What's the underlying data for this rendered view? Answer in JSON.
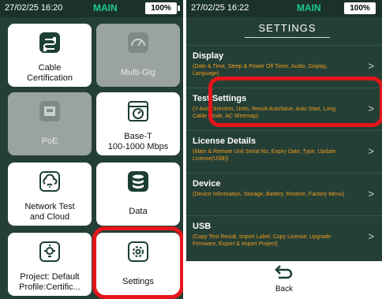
{
  "left_screen": {
    "status": {
      "time": "27/02/25 16:20",
      "title": "MAIN",
      "battery": "100%"
    },
    "tiles": [
      {
        "label": "Cable\nCertification",
        "icon": "cable-icon",
        "disabled": false
      },
      {
        "label": "Multi-Gig",
        "icon": "speedometer-icon",
        "disabled": true
      },
      {
        "label": "PoE",
        "icon": "ethernet-port-icon",
        "disabled": true
      },
      {
        "label": "Base-T\n100-1000 Mbps",
        "icon": "speed-meter-icon",
        "disabled": false
      },
      {
        "label": "Network Test\nand Cloud",
        "icon": "cloud-wifi-icon",
        "disabled": false
      },
      {
        "label": "Data",
        "icon": "database-icon",
        "disabled": false
      },
      {
        "label": "Project: Default\nProfile:Certific...",
        "icon": "lightbulb-icon",
        "disabled": false
      },
      {
        "label": "Settings",
        "icon": "gear-icon",
        "disabled": false
      }
    ],
    "highlighted_tile": "Settings"
  },
  "right_screen": {
    "status": {
      "time": "27/02/25 16:22",
      "title": "MAIN",
      "battery": "100%"
    },
    "heading": "SETTINGS",
    "items": [
      {
        "title": "Display",
        "desc": "(Date & Time, Sleep & Power Off Timer, Audio, Display, Language)"
      },
      {
        "title": "Test Settings",
        "desc": "(Y-Axis Direction, Units, Result AutoSave, Auto Start, Long Cable Mode, AC Wiremap)"
      },
      {
        "title": "License Details",
        "desc": "(Main & Remote Unit Serial No, Expiry Date, Type, Update License(USB))"
      },
      {
        "title": "Device",
        "desc": "(Device Information, Storage, Battery, Restore, Factory Menu)"
      },
      {
        "title": "USB",
        "desc": "(Copy Test Result, Import Label, Copy License, Upgrade Firmware, Export & Import Project)"
      }
    ],
    "highlighted_item": "Test Settings",
    "back_label": "Back"
  },
  "colors": {
    "panel_bg": "#243f36",
    "accent": "#1fc98a",
    "highlight": "#e4161c",
    "desc_text": "#f39c1e"
  }
}
